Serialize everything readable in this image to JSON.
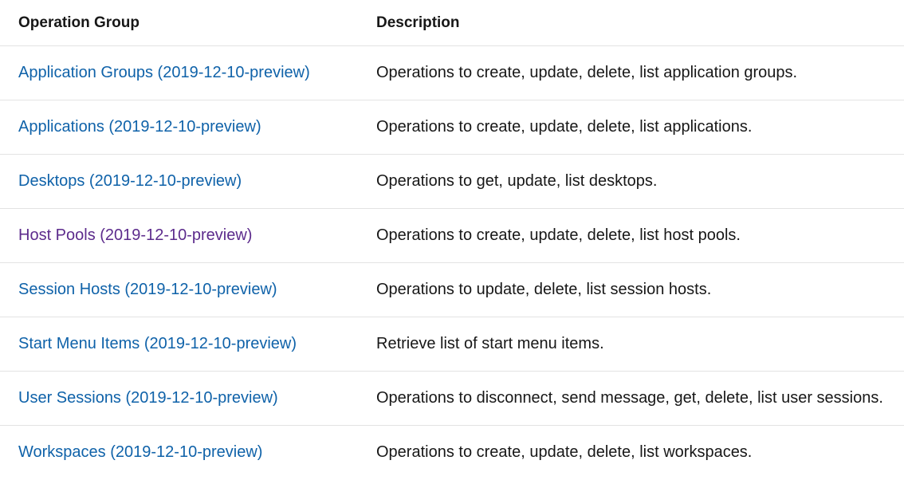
{
  "table": {
    "headers": {
      "operation_group": "Operation Group",
      "description": "Description"
    },
    "rows": [
      {
        "name": "Application Groups (2019-12-10-preview)",
        "description": "Operations to create, update, delete, list application groups.",
        "visited": false
      },
      {
        "name": "Applications (2019-12-10-preview)",
        "description": "Operations to create, update, delete, list applications.",
        "visited": false
      },
      {
        "name": "Desktops (2019-12-10-preview)",
        "description": "Operations to get, update, list desktops.",
        "visited": false
      },
      {
        "name": "Host Pools (2019-12-10-preview)",
        "description": "Operations to create, update, delete, list host pools.",
        "visited": true
      },
      {
        "name": "Session Hosts (2019-12-10-preview)",
        "description": "Operations to update, delete, list session hosts.",
        "visited": false
      },
      {
        "name": "Start Menu Items (2019-12-10-preview)",
        "description": "Retrieve list of start menu items.",
        "visited": false
      },
      {
        "name": "User Sessions (2019-12-10-preview)",
        "description": "Operations to disconnect, send message, get, delete, list user sessions.",
        "visited": false
      },
      {
        "name": "Workspaces (2019-12-10-preview)",
        "description": "Operations to create, update, delete, list workspaces.",
        "visited": false
      }
    ]
  },
  "colors": {
    "link": "#0f62a9",
    "visited_link": "#5c2b8c",
    "text": "#171717",
    "divider": "#e3e3e3"
  }
}
